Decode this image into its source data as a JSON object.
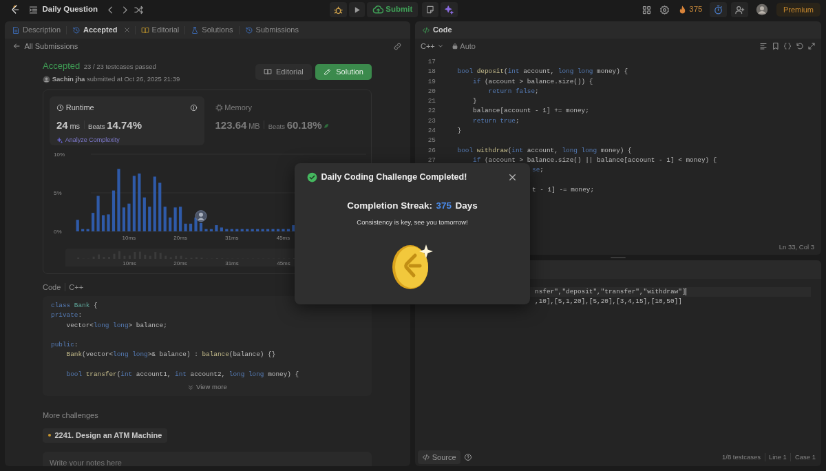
{
  "topbar": {
    "title": "Daily Question",
    "submit": "Submit",
    "streak": "375",
    "premium": "Premium"
  },
  "left_tabs": [
    {
      "label": "Description",
      "selected": false
    },
    {
      "label": "Accepted",
      "selected": true
    },
    {
      "label": "Editorial",
      "selected": false
    },
    {
      "label": "Solutions",
      "selected": false
    },
    {
      "label": "Submissions",
      "selected": false
    }
  ],
  "back_link": "All Submissions",
  "result": {
    "status": "Accepted",
    "testcases": "23 / 23 testcases passed",
    "author": "Sachin jha",
    "submitted": "submitted at Oct 26, 2025 21:39",
    "buttons": [
      {
        "label": "Editorial",
        "kind": "plain"
      },
      {
        "label": "Solution",
        "kind": "primary"
      }
    ]
  },
  "stats": [
    {
      "title": "Runtime",
      "value": "24",
      "unit": "ms",
      "beats_label": "Beats",
      "beats": "14.74%",
      "selected": true,
      "action": "Analyze Complexity"
    },
    {
      "title": "Memory",
      "value": "123.64",
      "unit": "MB",
      "beats_label": "Beats",
      "beats": "60.18%",
      "selected": false
    }
  ],
  "chart": {
    "chart_data": {
      "type": "bar",
      "categories": [
        null,
        null,
        null,
        null,
        null,
        null,
        null,
        null,
        null,
        null,
        "10ms",
        null,
        null,
        null,
        null,
        null,
        null,
        null,
        null,
        null,
        "20ms",
        null,
        null,
        null,
        null,
        null,
        null,
        null,
        null,
        null,
        "31ms",
        null,
        null,
        null,
        null,
        null,
        null,
        null,
        null,
        null,
        "45ms",
        null,
        null
      ],
      "series": [
        {
          "color": "#2f5aa8",
          "values": [
            1.5,
            0.3,
            0.3,
            2.4,
            4.6,
            2.1,
            2.2,
            5.3,
            8.1,
            3.1,
            3.6,
            7.2,
            7.5,
            4.4,
            3.2,
            7.1,
            6.3,
            3.2,
            1.8,
            3.1,
            3.2,
            1.0,
            1.0,
            1.8,
            1.1,
            0.3,
            0.3,
            0.8,
            0.5,
            0.3,
            0.3,
            0.3,
            0.3,
            0.3,
            0.3,
            0.3,
            0.3,
            0.3,
            0.3,
            0.3,
            0.3,
            0.3,
            0.8
          ]
        }
      ],
      "ylim": [
        0,
        10
      ],
      "yticks": [
        {
          "value": 0,
          "label": "0%"
        },
        {
          "value": 5,
          "label": "5%"
        },
        {
          "value": 10,
          "label": "10%"
        }
      ]
    },
    "overview_labels": [
      "10ms",
      "20ms",
      "31ms",
      "45ms"
    ]
  },
  "submitted_code": {
    "label": "Code",
    "language": "C++",
    "view_more": "View more",
    "lines": [
      {
        "kind": "code",
        "segments": [
          {
            "kind": "kw",
            "text": "class"
          },
          {
            "kind": "type",
            "text": " Bank"
          },
          {
            "kind": "plain",
            "text": " {"
          }
        ]
      },
      {
        "kind": "code",
        "segments": [
          {
            "kind": "kw",
            "text": "private"
          },
          {
            "kind": "plain",
            "text": ":"
          }
        ]
      },
      {
        "kind": "code",
        "segments": [
          {
            "kind": "plain",
            "text": "    vector<"
          },
          {
            "kind": "kw",
            "text": "long long"
          },
          {
            "kind": "plain",
            "text": "> balance;"
          }
        ]
      },
      {
        "kind": "blank"
      },
      {
        "kind": "code",
        "segments": [
          {
            "kind": "kw",
            "text": "public"
          },
          {
            "kind": "plain",
            "text": ":"
          }
        ]
      },
      {
        "kind": "code",
        "segments": [
          {
            "kind": "fn",
            "text": "    Bank"
          },
          {
            "kind": "plain",
            "text": "(vector<"
          },
          {
            "kind": "kw",
            "text": "long long"
          },
          {
            "kind": "plain",
            "text": ">& balance) : "
          },
          {
            "kind": "fn",
            "text": "balance"
          },
          {
            "kind": "plain",
            "text": "(balance) {}"
          }
        ]
      },
      {
        "kind": "blank"
      },
      {
        "kind": "code",
        "segments": [
          {
            "kind": "kw",
            "text": "    bool"
          },
          {
            "kind": "fn",
            "text": " transfer"
          },
          {
            "kind": "plain",
            "text": "("
          },
          {
            "kind": "kw",
            "text": "int"
          },
          {
            "kind": "plain",
            "text": " account1, "
          },
          {
            "kind": "kw",
            "text": "int"
          },
          {
            "kind": "plain",
            "text": " account2, "
          },
          {
            "kind": "kw",
            "text": "long long"
          },
          {
            "kind": "plain",
            "text": " money) {"
          }
        ]
      }
    ]
  },
  "more_challenges": {
    "title": "More challenges",
    "items": [
      {
        "label": "2241. Design an ATM Machine",
        "color": "#c9962e"
      }
    ]
  },
  "notes": {
    "placeholder": "Write your notes here"
  },
  "code_panel": {
    "title": "Code",
    "language": "C++",
    "mode": "Auto",
    "cursor": "Ln 33, Col 3",
    "lines": [
      {
        "num": "17",
        "kind": "blank"
      },
      {
        "num": "18",
        "kind": "code",
        "segments": [
          {
            "kind": "kw",
            "text": "    bool"
          },
          {
            "kind": "fn",
            "text": " deposit"
          },
          {
            "kind": "plain",
            "text": "("
          },
          {
            "kind": "kw",
            "text": "int"
          },
          {
            "kind": "plain",
            "text": " account, "
          },
          {
            "kind": "kw",
            "text": "long long"
          },
          {
            "kind": "plain",
            "text": " money) {"
          }
        ]
      },
      {
        "num": "19",
        "kind": "code",
        "segments": [
          {
            "kind": "kw",
            "text": "        if"
          },
          {
            "kind": "plain",
            "text": " (account > balance.size()) {"
          }
        ]
      },
      {
        "num": "20",
        "kind": "code",
        "segments": [
          {
            "kind": "kw",
            "text": "            return false"
          },
          {
            "kind": "plain",
            "text": ";"
          }
        ]
      },
      {
        "num": "21",
        "kind": "code",
        "segments": [
          {
            "kind": "plain",
            "text": "        }"
          }
        ]
      },
      {
        "num": "22",
        "kind": "code",
        "segments": [
          {
            "kind": "plain",
            "text": "        balance[account - 1] += money;"
          }
        ]
      },
      {
        "num": "23",
        "kind": "code",
        "segments": [
          {
            "kind": "kw",
            "text": "        return true"
          },
          {
            "kind": "plain",
            "text": ";"
          }
        ]
      },
      {
        "num": "24",
        "kind": "code",
        "segments": [
          {
            "kind": "plain",
            "text": "    }"
          }
        ]
      },
      {
        "num": "25",
        "kind": "blank"
      },
      {
        "num": "26",
        "kind": "code",
        "segments": [
          {
            "kind": "kw",
            "text": "    bool"
          },
          {
            "kind": "fn",
            "text": " withdraw"
          },
          {
            "kind": "plain",
            "text": "("
          },
          {
            "kind": "kw",
            "text": "int"
          },
          {
            "kind": "plain",
            "text": " account, "
          },
          {
            "kind": "kw",
            "text": "long long"
          },
          {
            "kind": "plain",
            "text": " money) {"
          }
        ]
      },
      {
        "num": "27",
        "kind": "code",
        "segments": [
          {
            "kind": "kw",
            "text": "        if"
          },
          {
            "kind": "plain",
            "text": " (account > balance.size() || balance[account - 1] < money) {"
          }
        ]
      },
      {
        "kind": "covered",
        "segments": [
          {
            "kind": "kw",
            "text": "se"
          },
          {
            "kind": "plain",
            "text": ";"
          }
        ]
      },
      {
        "kind": "hidden"
      },
      {
        "kind": "covered",
        "segments": [
          {
            "kind": "plain",
            "text": "t - 1] -= money;"
          }
        ]
      }
    ]
  },
  "testcase": {
    "lines": [
      {
        "text": "nsfer\",\"deposit\",\"transfer\",\"withdraw\"]",
        "selected": true
      },
      {
        "text": ",10],[5,1,20],[5,20],[3,4,15],[10,50]]",
        "selected": false
      }
    ]
  },
  "footer": {
    "source": "Source",
    "testcases": "1/8 testcases",
    "line": "Line 1",
    "case": "Case 1"
  },
  "modal": {
    "title": "Daily Coding Challenge Completed!",
    "streak_label": "Completion Streak:",
    "streak_value": "375",
    "streak_unit": "Days",
    "message": "Consistency is key, see you tomorrow!"
  }
}
